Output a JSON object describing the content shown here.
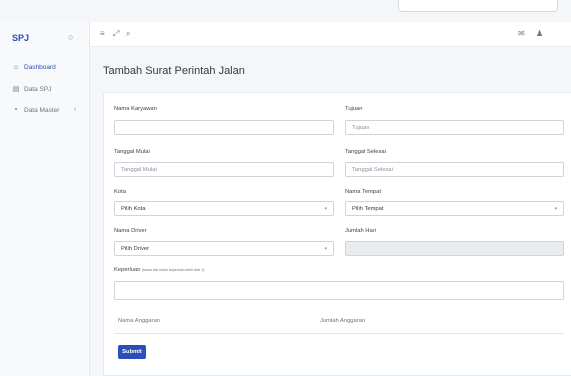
{
  "brand": "SPJ",
  "sidebar": {
    "toggle_icon": "circle-icon",
    "items": [
      {
        "label": "Dashboard",
        "icon": "home-icon",
        "active": true
      },
      {
        "label": "Data SPJ",
        "icon": "document-icon",
        "active": false
      },
      {
        "label": "Data Master",
        "icon": "pin-icon",
        "active": false,
        "chevron": "‹"
      }
    ]
  },
  "topbar": {
    "icons": [
      "menu-icon",
      "expand-icon",
      "search-icon",
      "mail-icon",
      "user-icon"
    ]
  },
  "page": {
    "title": "Tambah Surat Perintah Jalan"
  },
  "form": {
    "nama_karyawan": {
      "label": "Nama Karyawan",
      "value": ""
    },
    "tujuan": {
      "label": "Tujuan",
      "placeholder": "Tujuan"
    },
    "tanggal_mulai": {
      "label": "Tanggal Mulai",
      "placeholder": "Tanggal Mulai"
    },
    "tanggal_selesai": {
      "label": "Tanggal Selesai",
      "placeholder": "Tanggal Selesai"
    },
    "kota": {
      "label": "Kota",
      "value": "Pilih Kota"
    },
    "nama_tempat": {
      "label": "Nama Tempat",
      "value": "Pilih Tempat"
    },
    "nama_driver": {
      "label": "Nama Driver",
      "value": "Pilih Driver"
    },
    "jumlah_hari": {
      "label": "Jumlah Hari",
      "value": ""
    },
    "keperluan": {
      "label": "Keperluan",
      "hint": "(tekan tab untuk keperluan lebih dari 1)",
      "value": ""
    }
  },
  "table": {
    "columns": [
      "Nama Anggaran",
      "Jumlah Anggaran"
    ]
  },
  "submit_label": "Submit",
  "colors": {
    "primary": "#2a4fb7",
    "background": "#f4f6f9"
  }
}
